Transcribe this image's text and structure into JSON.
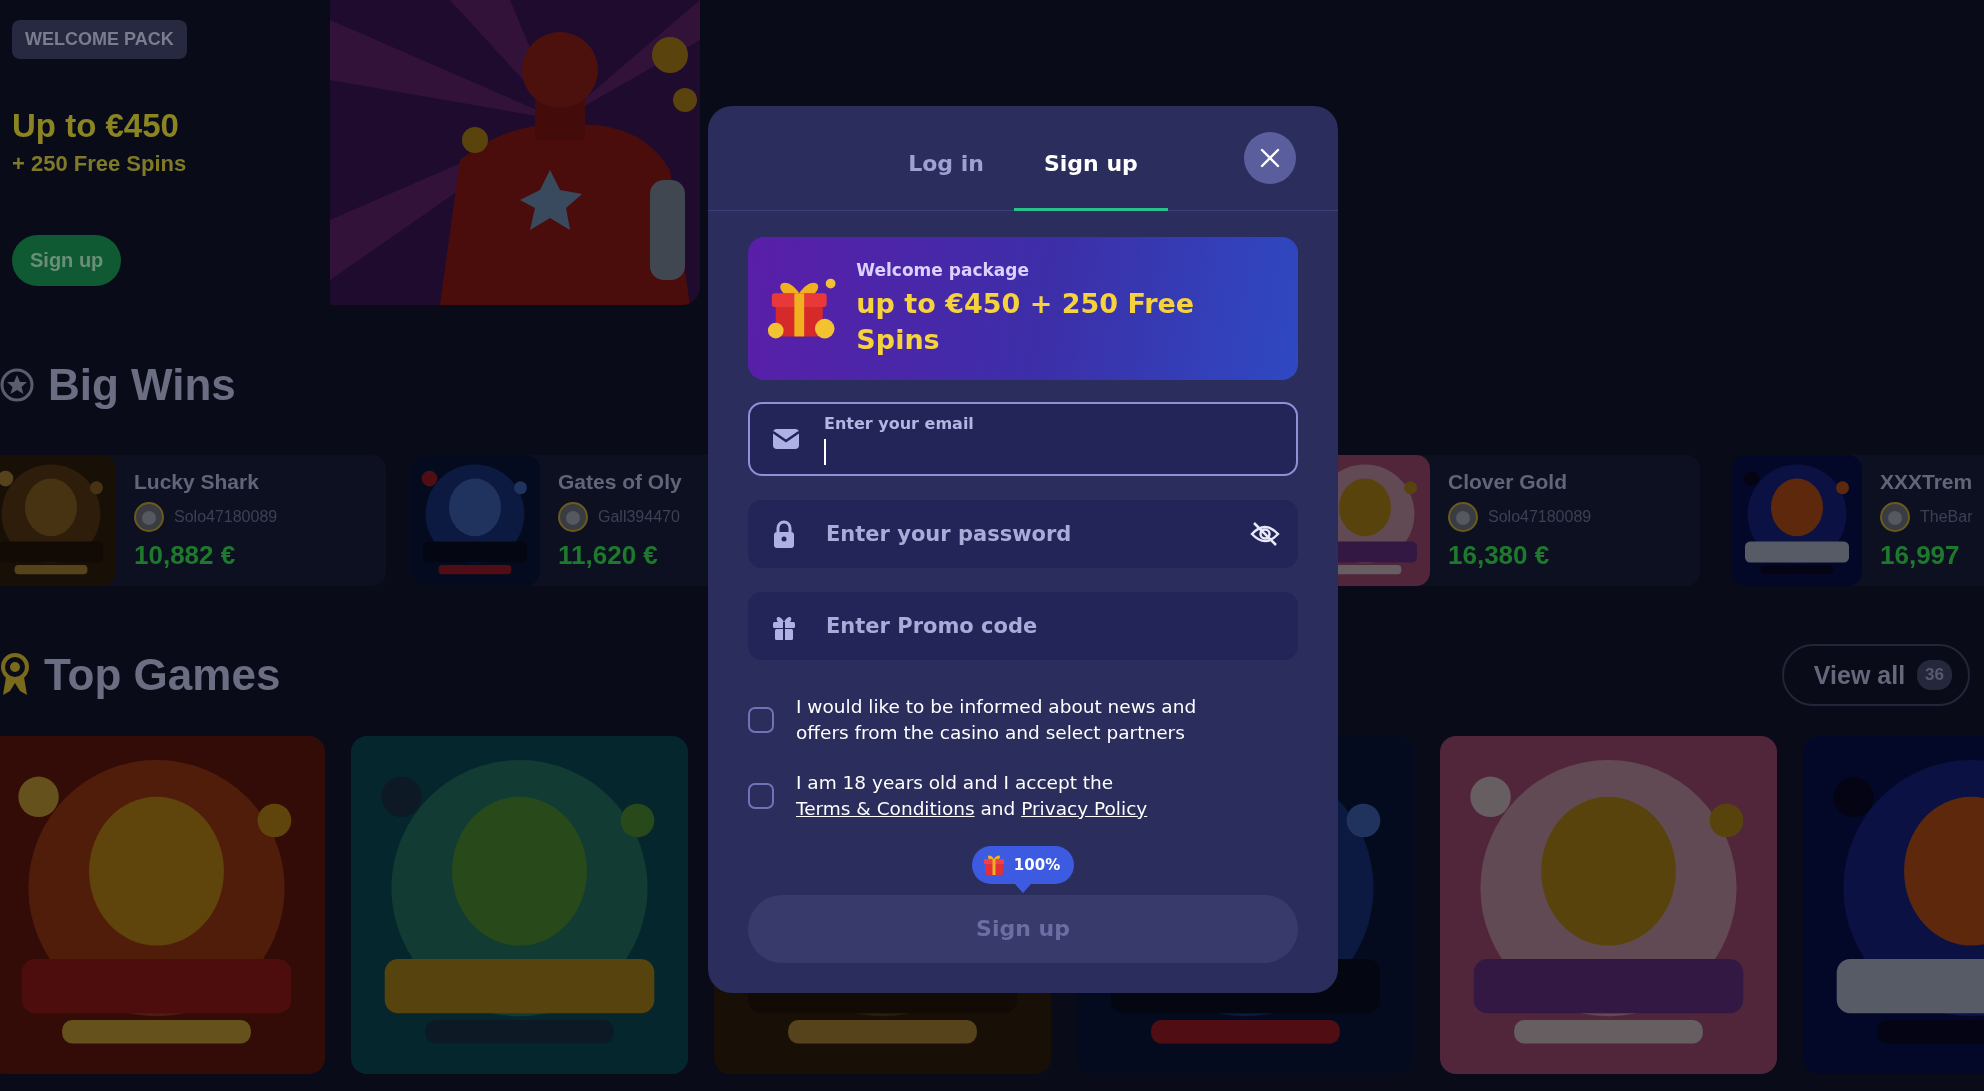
{
  "banner": {
    "badge": "WELCOME PACK",
    "title": "Up to €450",
    "subtitle": "+ 250 Free Spins",
    "button": "Sign up"
  },
  "big_wins": {
    "title": "Big Wins",
    "cards": [
      {
        "game": "Lucky Shark",
        "player": "Solo47180089",
        "amount": "10,882 €"
      },
      {
        "game": "Gates of Oly",
        "player": "Gall394470",
        "amount": "11,620 €"
      },
      {
        "game": "Clover Gold",
        "player": "Solo47180089",
        "amount": "16,380 €"
      },
      {
        "game": "XXXTrem",
        "player": "TheBar",
        "amount": "16,997"
      }
    ]
  },
  "top_games": {
    "title": "Top Games",
    "view_all": "View all",
    "count": "36"
  },
  "auth_modal": {
    "tabs": [
      {
        "label": "Log in",
        "selected": false
      },
      {
        "label": "Sign up",
        "selected": true
      }
    ],
    "promo": {
      "caption": "Welcome package",
      "offer": "up to €450 + 250 Free Spins"
    },
    "fields": [
      {
        "kind": "email",
        "label": "Enter your email",
        "focused": true
      },
      {
        "kind": "password",
        "placeholder": "Enter your password",
        "focused": false
      },
      {
        "kind": "promo",
        "placeholder": "Enter Promo code",
        "focused": false
      }
    ],
    "consents": [
      {
        "checked": false,
        "parts": [
          {
            "text": "I would like to be informed about news and offers from the casino and select partners"
          }
        ]
      },
      {
        "checked": false,
        "parts": [
          {
            "text": "I am 18 years old and I accept the"
          },
          {
            "link": "Terms & Conditions"
          },
          {
            "text": "and"
          },
          {
            "link": "Privacy Policy"
          }
        ]
      }
    ],
    "bonus_badge": "100%",
    "submit": {
      "label": "Sign up",
      "disabled": true
    }
  }
}
